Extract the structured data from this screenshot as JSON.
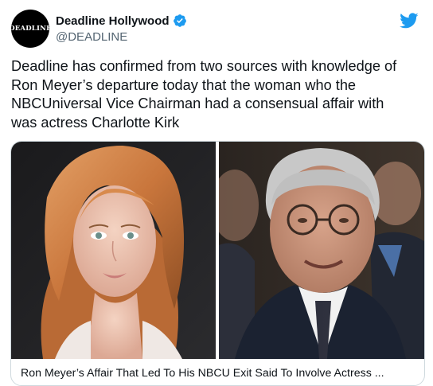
{
  "account": {
    "avatar_text": "DEADLINE",
    "display_name": "Deadline Hollywood",
    "handle": "@DEADLINE",
    "verified": true
  },
  "tweet": {
    "text": "Deadline has confirmed from two sources with knowledge of\nRon Meyer’s departure today that the woman who the\nNBCUniversal Vice Chairman had a consensual affair with\nwas actress Charlotte Kirk"
  },
  "card": {
    "title": "Ron Meyer’s Affair That Led To His NBCU Exit Said To Involve Actress ..."
  },
  "colors": {
    "brand_blue": "#1d9bf0",
    "text_primary": "#0f1419",
    "text_secondary": "#536471",
    "border": "#cfd9de"
  },
  "icons": [
    "twitter-bird-icon",
    "verified-badge-icon"
  ]
}
